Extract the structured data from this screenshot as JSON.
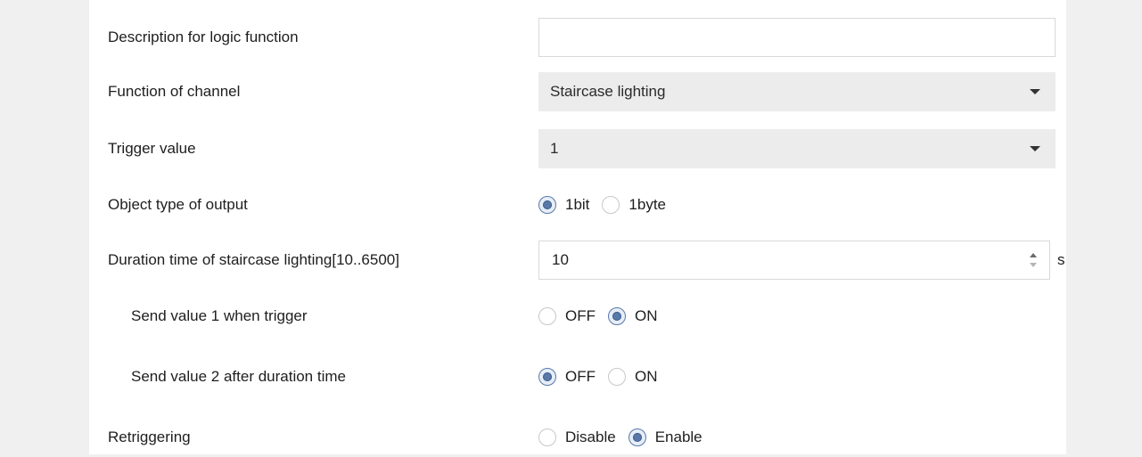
{
  "rows": {
    "description": {
      "label": "Description for logic function",
      "value": ""
    },
    "function": {
      "label": "Function of channel",
      "value": "Staircase lighting"
    },
    "trigger": {
      "label": "Trigger value",
      "value": "1"
    },
    "object_type": {
      "label": "Object type of  output",
      "options": [
        "1bit",
        "1byte"
      ],
      "selected": "1bit"
    },
    "duration": {
      "label": "Duration time of staircase lighting[10..6500]",
      "value": "10",
      "unit": "s"
    },
    "send1": {
      "label": "Send value 1 when trigger",
      "options": [
        "OFF",
        "ON"
      ],
      "selected": "ON"
    },
    "send2": {
      "label": "Send value 2 after duration time",
      "options": [
        "OFF",
        "ON"
      ],
      "selected": "OFF"
    },
    "retrigger": {
      "label": "Retriggering",
      "options": [
        "Disable",
        "Enable"
      ],
      "selected": "Enable"
    }
  },
  "colors": {
    "radio_selected": "#5a79a8",
    "panel": "#ffffff",
    "background": "#f0f0f0",
    "select_bg": "#ececec"
  }
}
